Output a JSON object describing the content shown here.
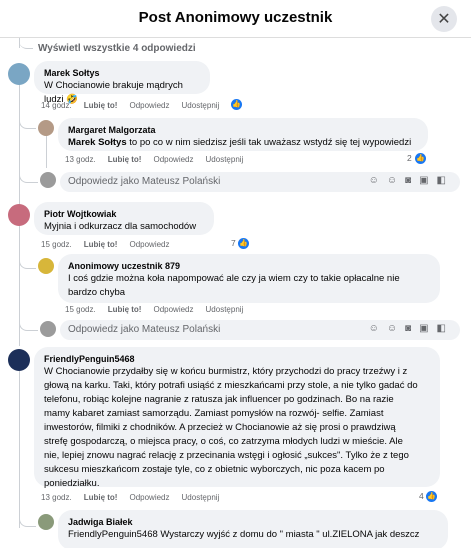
{
  "header": {
    "title": "Post Anonimowy uczestnik"
  },
  "view_all": "Wyświetl wszystkie 4 odpowiedzi",
  "actions": {
    "like": "Lubię to!",
    "reply": "Odpowiedz",
    "share": "Udostępnij"
  },
  "reply_placeholder": "Odpowiedz jako Mateusz Polański",
  "comments": [
    {
      "name": "Marek Sołtys",
      "text": "W Chocianowie brakuje mądrych ludzi 🤣",
      "time": "14 godz."
    },
    {
      "name": "Margaret Malgorzata",
      "bold": "Marek Sołtys",
      "text": " to po co w nim siedzisz jeśli tak uważasz wstydź się tej wypowiedzi",
      "time": "13 godz.",
      "likes": "2"
    },
    {
      "name": "Piotr Wojtkowiak",
      "text": "Myjnia i odkurzacz dla samochodów",
      "time": "15 godz.",
      "likes": "7"
    },
    {
      "name": "Anonimowy uczestnik 879",
      "text1": "I coś gdzie można koła napompować ale czy ja wiem czy to takie opłacalne nie",
      "text2": "bardzo chyba",
      "time": "15 godz."
    },
    {
      "name": "FriendlyPenguin5468",
      "lines": [
        "W Chocianowie przydałby się w końcu burmistrz, który przychodzi do pracy trzeźwy i z",
        "głową na karku. Taki, który potrafi usiąść z mieszkańcami przy stole, a nie tylko gadać do",
        "telefonu, robiąc kolejne nagranie z ratusza jak influencer po godzinach. Bo na razie",
        "mamy kabaret zamiast samorządu. Zamiast pomysłów na rozwój- selfie. Zamiast",
        "inwestorów, filmiki z chodników. A przecież w Chocianowie aż się prosi o prawdziwą",
        "strefę gospodarczą, o miejsca pracy, o coś, co zatrzyma młodych ludzi w mieście. Ale",
        "nie, lepiej znowu nagrać relację z przecinania wstęgi i ogłosić „sukces\". Tylko że z tego",
        "sukcesu mieszkańcom zostaje tyle, co z obietnic wyborczych, nic poza kacem po",
        "poniedziałku."
      ],
      "time": "13 godz.",
      "likes": "4"
    },
    {
      "name": "Jadwiga Białek",
      "text": "FriendlyPenguin5468 Wystarczy wyjść z domu do \" miasta \" ul.ZIELONA jak deszcz"
    }
  ],
  "colors": {
    "like_blue": "#1877f2",
    "bubble": "#f0f2f5",
    "meta": "#65676b"
  }
}
